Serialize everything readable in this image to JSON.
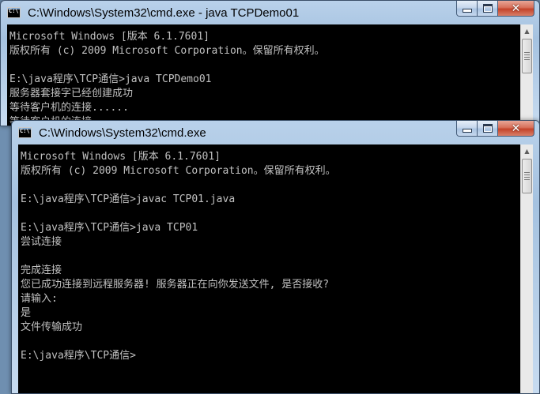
{
  "window_back": {
    "title": "C:\\Windows\\System32\\cmd.exe - java  TCPDemo01",
    "icon_label": "C:\\",
    "console_lines": [
      "Microsoft Windows [版本 6.1.7601]",
      "版权所有 (c) 2009 Microsoft Corporation。保留所有权利。",
      "",
      "E:\\java程序\\TCP通信>java TCPDemo01",
      "服务器套接字已经创建成功",
      "等待客户机的连接......",
      "等待客户机的连接......"
    ]
  },
  "window_front": {
    "title": "C:\\Windows\\System32\\cmd.exe",
    "icon_label": "C:\\",
    "console_lines": [
      "Microsoft Windows [版本 6.1.7601]",
      "版权所有 (c) 2009 Microsoft Corporation。保留所有权利。",
      "",
      "E:\\java程序\\TCP通信>javac TCP01.java",
      "",
      "E:\\java程序\\TCP通信>java TCP01",
      "尝试连接",
      "",
      "完成连接",
      "您已成功连接到远程服务器! 服务器正在向你发送文件, 是否接收?",
      "请输入:",
      "是",
      "文件传输成功",
      "",
      "E:\\java程序\\TCP通信>"
    ]
  },
  "controls": {
    "close_glyph": "✕",
    "scroll_up_glyph": "▲"
  },
  "colors": {
    "console_bg": "#000000",
    "console_text": "#c0c0c0",
    "title_bar": "#b9d1ea",
    "close_button": "#c4432a"
  }
}
